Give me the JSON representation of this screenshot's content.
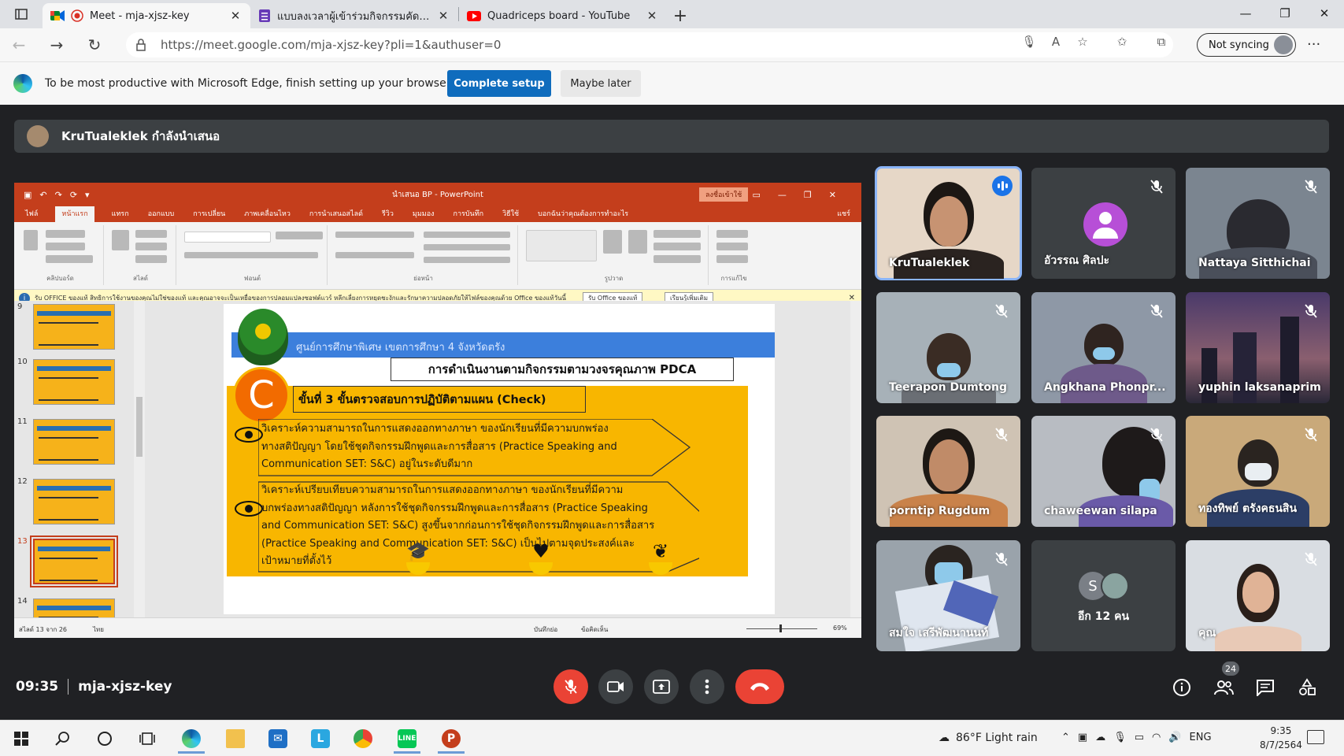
{
  "browser": {
    "tabs": [
      {
        "title": "Meet - mja-xjsz-key",
        "icon": "google-meet-icon",
        "active": true
      },
      {
        "title": "แบบลงเวลาผู้เข้าร่วมกิจกรรมคัดเลือกฯ",
        "icon": "google-forms-icon",
        "active": false
      },
      {
        "title": "Quadriceps board - YouTube",
        "icon": "youtube-icon",
        "active": false
      }
    ],
    "url": "https://meet.google.com/mja-xjsz-key?pli=1&authuser=0",
    "profile_label": "Not syncing",
    "infobar": {
      "message": "To be most productive with Microsoft Edge, finish setting up your browser.",
      "primary_button": "Complete setup",
      "secondary_button": "Maybe later"
    }
  },
  "meet": {
    "presenter_banner": "KruTualeklek กำลังนำเสนอ",
    "time": "09:35",
    "meeting_code": "mja-xjsz-key",
    "participants_count": "24",
    "participants": [
      {
        "name": "KruTualeklek",
        "speaking": true
      },
      {
        "name": "อัวรรณ ศิลปะ",
        "muted": true
      },
      {
        "name": "Nattaya Sitthichai",
        "muted": true
      },
      {
        "name": "Teerapon Dumtong",
        "muted": true
      },
      {
        "name": "Angkhana Phonpr...",
        "muted": true
      },
      {
        "name": "yuphin laksanaprim",
        "muted": true
      },
      {
        "name": "porntip Rugdum",
        "muted": true
      },
      {
        "name": "chaweewan silapa",
        "muted": true
      },
      {
        "name": "ทองทิพย์ ตรังคธนสิน",
        "muted": true
      },
      {
        "name": "สมใจ เสรีพัฒนานนท์",
        "muted": true
      },
      {
        "name": "อีก 12 คน",
        "more_initial": "S"
      },
      {
        "name": "คุณ",
        "muted": true
      }
    ]
  },
  "powerpoint": {
    "window_title": "นำเสนอ BP - PowerPoint",
    "sign_in": "ลงชื่อเข้าใช้",
    "menu": [
      "ไฟล์",
      "หน้าแรก",
      "แทรก",
      "ออกแบบ",
      "การเปลี่ยน",
      "ภาพเคลื่อนไหว",
      "การนำเสนอสไลด์",
      "รีวิว",
      "มุมมอง",
      "การบันทึก",
      "วิธีใช้",
      "บอกฉันว่าคุณต้องการทำอะไร"
    ],
    "share_label": "แชร์",
    "ribbon_groups": [
      "คลิปบอร์ด",
      "สไลด์",
      "ฟอนต์",
      "ย่อหน้า",
      "รูปวาด",
      "การแก้ไข"
    ],
    "message": "รับ OFFICE ของแท้  สิทธิการใช้งานของคุณไม่ใช่ของแท้ และคุณอาจจะเป็นเหยื่อของการปลอมแปลงซอฟต์แวร์ หลีกเลี่ยงการหยุดชะงักและรักษาความปลอดภัยให้ไฟล์ของคุณด้วย Office ของแท้วันนี้",
    "message_btn1": "รับ Office ของแท้",
    "message_btn2": "เรียนรู้เพิ่มเติม",
    "thumbnails": [
      "9",
      "10",
      "11",
      "12",
      "13",
      "14"
    ],
    "selected_slide": "13",
    "status_slide": "สไลด์ 13 จาก 26",
    "status_lang": "ไทย",
    "status_notes": "บันทึกย่อ",
    "status_comments": "ข้อคิดเห็น",
    "zoom": "69%",
    "slide": {
      "header": "ศูนย์การศึกษาพิเศษ เขตการศึกษา 4 จังหวัดตรัง",
      "title": "การดำเนินงานตามกิจกรรมตามวงจรคุณภาพ PDCA",
      "letter": "C",
      "step": "ขั้นที่ 3 ขั้นตรวจสอบการปฏิบัติตามแผน (Check)",
      "item1_lines": [
        "วิเคราะห์ความสามารถในการแสดงออกทางภาษา ของนักเรียนที่มีความบกพร่อง",
        "ทางสติปัญญา โดยใช้ชุดกิจกรรมฝึกพูดและการสื่อสาร (Practice Speaking and",
        "Communication SET: S&C) อยู่ในระดับดีมาก"
      ],
      "item2_lines": [
        "วิเคราะห์เปรียบเทียบความสามารถในการแสดงออกทางภาษา ของนักเรียนที่มีความ",
        "บกพร่องทางสติปัญญา หลังการใช้ชุดกิจกรรมฝึกพูดและการสื่อสาร (Practice Speaking",
        "and Communication SET: S&C) สูงขึ้นจากก่อนการใช้ชุดกิจกรรมฝึกพูดและการสื่อสาร",
        "(Practice Speaking and Communication SET: S&C)  เป็นไปตามจุดประสงค์และ",
        "เป้าหมายที่ตั้งไว้"
      ]
    }
  },
  "taskbar": {
    "weather": "86°F  Light rain",
    "lang": "ENG",
    "time": "9:35",
    "date": "8/7/2564"
  },
  "colors": {
    "meet_bg": "#202124",
    "tile_bg": "#3c4043",
    "end_call": "#ea4335",
    "ppt_red": "#c43e1c",
    "slide_orange": "#f8b600",
    "edge_blue": "#0f6cbd"
  }
}
